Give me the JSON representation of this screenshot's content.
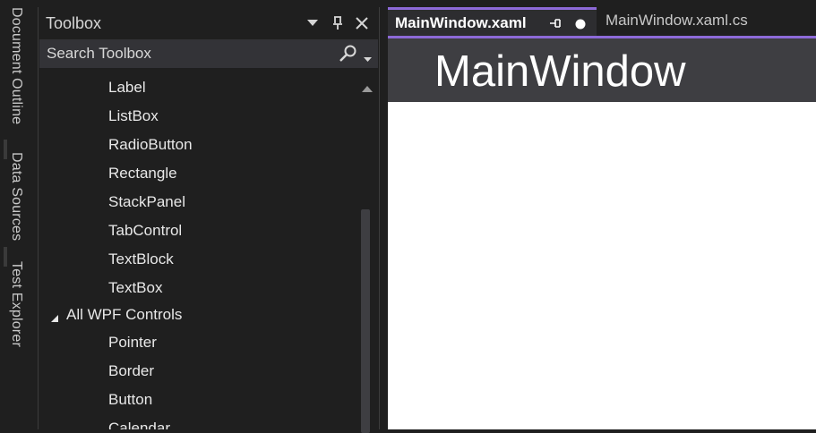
{
  "side_tabs": [
    "Document Outline",
    "Data Sources",
    "Test Explorer"
  ],
  "toolbox": {
    "title": "Toolbox",
    "search_placeholder": "Search Toolbox",
    "items_above": [
      "Label",
      "ListBox",
      "RadioButton",
      "Rectangle",
      "StackPanel",
      "TabControl",
      "TextBlock",
      "TextBox"
    ],
    "group_label": "All WPF Controls",
    "items_below": [
      "Pointer",
      "Border",
      "Button",
      "Calendar"
    ]
  },
  "editor": {
    "tabs": [
      {
        "label": "MainWindow.xaml",
        "active": true
      },
      {
        "label": "MainWindow.xaml.cs",
        "active": false
      }
    ],
    "window_title": "MainWindow"
  },
  "colors": {
    "accent": "#8d6ad8",
    "panel": "#1f1f1f",
    "canvas": "#ffffff"
  }
}
